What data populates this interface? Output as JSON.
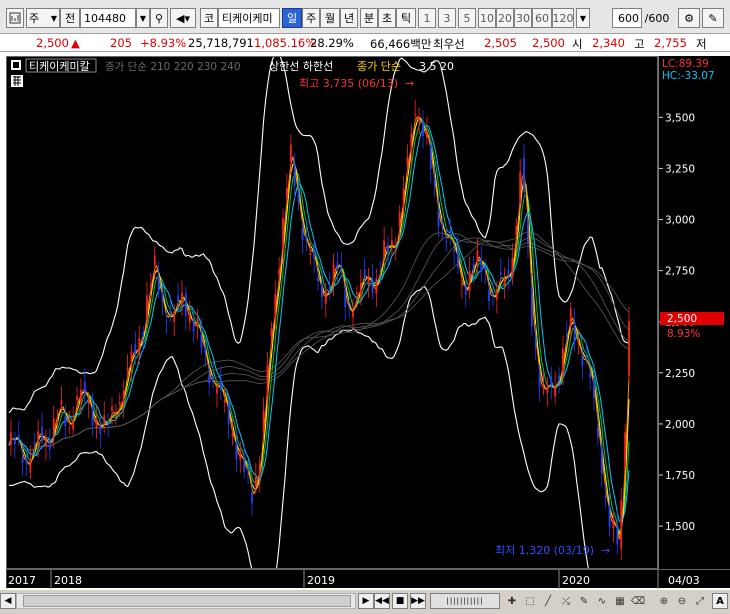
{
  "toolbar": {
    "market_label": "주",
    "prefix_label": "전",
    "code_value": "104480",
    "company_label": "티케이케미",
    "period_day": "일",
    "period_week": "주",
    "period_month": "월",
    "period_year": "년",
    "period_min": "분",
    "period_sec": "초",
    "period_tick": "틱",
    "interval_buttons": [
      "1",
      "3",
      "5",
      "10",
      "20",
      "30",
      "60",
      "120"
    ],
    "count_value": "600",
    "count_total": "/600",
    "code_prefix": "코"
  },
  "quote": {
    "price": "2,500",
    "change": "205",
    "change_pct": "+8.93%",
    "volume": "25,718,791",
    "volume_ratio": "1,085.16%",
    "turnover": "28.29%",
    "amount": "66,466백만",
    "priority_label": "최우선",
    "priority_price": "2,505",
    "priority_price2": "2,500",
    "open_label": "시",
    "open_value": "2,340",
    "high_label": "고",
    "high_value": "2,755",
    "low_label": "저"
  },
  "legend": {
    "name": "티케이케미칼",
    "ma_text": "종가 단순 210 220 230 240",
    "limits_text": "상한선 하한선",
    "ma2_text": "종가 단순",
    "ma2_periods": "3  5  20"
  },
  "annotations": {
    "max_label": "최고 3,735 (06/13)",
    "min_label": "최저 1,320 (03/19)",
    "lc_label": "LC:89.39",
    "hc_label": "HC:-33.07",
    "current_price_tag": "2,500",
    "current_pct": "8.93%"
  },
  "axis": {
    "y_ticks": [
      "3,500",
      "3,250",
      "3,000",
      "2,750",
      "2,500",
      "2,250",
      "2,000",
      "1,750",
      "1,500"
    ],
    "x_ticks": [
      "2017",
      "2018",
      "2019",
      "2020",
      "04/03"
    ]
  },
  "colors": {
    "price_up": "#ff2020",
    "price_down": "#2040ff",
    "band": "#ffffff",
    "ma_orange": "#ff8c00",
    "ma_yellow": "#ffff00",
    "ma_green": "#00c040",
    "ma_cyan": "#00c8ff",
    "accent_blue": "#2b63d6"
  },
  "chart_data": {
    "type": "line",
    "title": "티케이케미칼",
    "ylim": [
      1300,
      3800
    ],
    "x_labels": [
      "2017",
      "2018",
      "2019",
      "2020",
      "04/03"
    ],
    "series": [
      {
        "name": "종가",
        "values": [
          1900,
          1880,
          1850,
          1900,
          1950,
          2050,
          2000,
          2150,
          2100,
          2050,
          1950,
          2100,
          2200,
          2350,
          2550,
          2750,
          2600,
          2500,
          2650,
          2500,
          2350,
          2250,
          2100,
          2000,
          1800,
          1650,
          1900,
          2400,
          2900,
          3300,
          3050,
          2850,
          2650,
          2700,
          2750,
          2600,
          2600,
          2750,
          2700,
          2850,
          2950,
          3200,
          3600,
          3400,
          3100,
          2950,
          2800,
          2700,
          2750,
          2800,
          2600,
          2700,
          2850,
          3250,
          2550,
          2100,
          2200,
          2300,
          2500,
          2400,
          2200,
          1900,
          1500,
          1400,
          2500
        ]
      }
    ]
  }
}
